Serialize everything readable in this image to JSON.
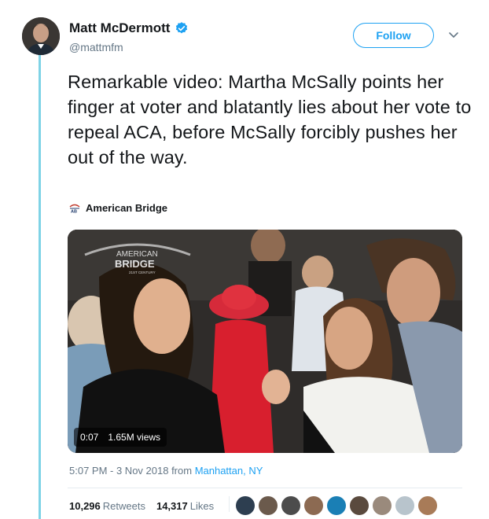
{
  "user": {
    "name": "Matt McDermott",
    "handle": "@mattmfm",
    "verified": true
  },
  "follow_label": "Follow",
  "tweet": {
    "text": "Remarkable video: Martha McSally points her finger at voter and blatantly lies about her vote to repeal ACA, before McSally forcibly pushes her out of the way."
  },
  "source": {
    "name": "American Bridge",
    "logo_text": "AB"
  },
  "video": {
    "duration": "0:07",
    "views": "1.65M views",
    "watermark": [
      "AMERICAN",
      "BRIDGE",
      "21ST CENTURY"
    ]
  },
  "meta": {
    "time": "5:07 PM - 3 Nov 2018 from ",
    "location": "Manhattan, NY"
  },
  "stats": {
    "retweets_count": "10,296",
    "retweets_label": "Retweets",
    "likes_count": "14,317",
    "likes_label": "Likes"
  },
  "colors": {
    "accent": "#1da1f2",
    "thread": "#7fd3e6",
    "muted": "#657786"
  }
}
